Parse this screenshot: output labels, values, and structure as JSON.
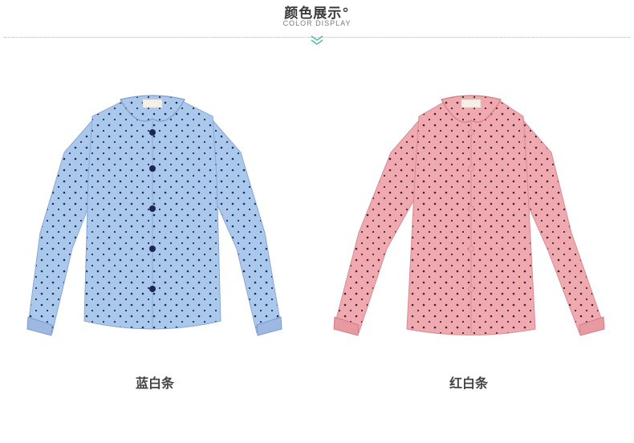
{
  "header": {
    "title": "颜色展示°",
    "subtitle": "COLOR DISPLAY"
  },
  "products": [
    {
      "label": "蓝白条",
      "color": "#a9c6ec",
      "dot": "#1f2a56",
      "button": "#1c2554"
    },
    {
      "label": "红白条",
      "color": "#f0a8ae",
      "dot": "#3a2238",
      "button": "#e9a7ad"
    }
  ]
}
